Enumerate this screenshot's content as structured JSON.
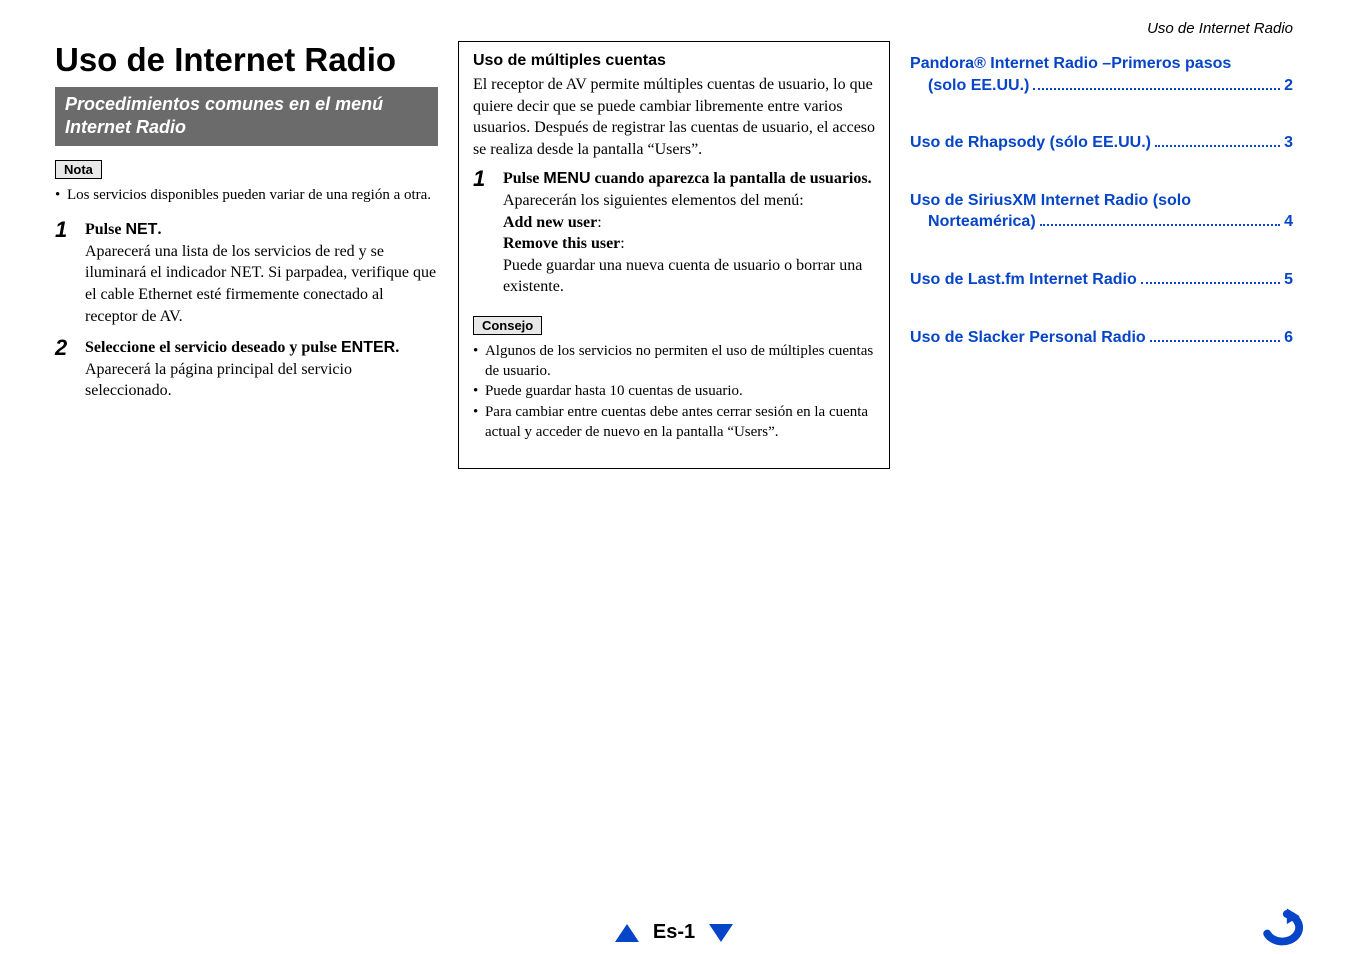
{
  "header": {
    "running_head": "Uso de Internet Radio"
  },
  "col1": {
    "title": "Uso de Internet Radio",
    "section_bar": "Procedimientos comunes en el menú Internet Radio",
    "nota_label": "Nota",
    "nota_bullet": "Los servicios disponibles pueden variar de una región a otra.",
    "steps": [
      {
        "num": "1",
        "lead_pre": "Pulse ",
        "lead_sans": "NET",
        "lead_post": ".",
        "body": "Aparecerá una lista de los servicios de red y se iluminará el indicador NET. Si parpadea, verifique que el cable Ethernet esté firmemente conectado al receptor de AV."
      },
      {
        "num": "2",
        "lead_pre": "Seleccione el servicio deseado y pulse ",
        "lead_sans": "ENTER",
        "lead_post": ".",
        "body": "Aparecerá la página principal del servicio seleccionado."
      }
    ]
  },
  "col2": {
    "heading": "Uso de múltiples cuentas",
    "intro": "El receptor de AV permite múltiples cuentas de usuario, lo que quiere decir que se puede cambiar libremente entre varios usuarios. Después de registrar las cuentas de usuario, el acceso se realiza desde la pantalla “Users”.",
    "step": {
      "num": "1",
      "lead_pre": "Pulse ",
      "lead_sans": "MENU",
      "lead_post": " cuando aparezca la pantalla de usuarios.",
      "after": "Aparecerán los siguientes elementos del menú:",
      "opt1": "Add new user",
      "opt2": "Remove this user",
      "tail": "Puede guardar una nueva cuenta de usuario o borrar una existente."
    },
    "consejo_label": "Consejo",
    "consejo_bullets": [
      "Algunos de los servicios no permiten el uso de múltiples cuentas de usuario.",
      "Puede guardar hasta 10 cuentas de usuario.",
      "Para cambiar entre cuentas debe antes cerrar sesión en la cuenta actual y acceder de nuevo en la pantalla “Users”."
    ]
  },
  "toc": [
    {
      "lines": [
        {
          "text": "Pandora® Internet Radio –Primeros pasos",
          "page": ""
        },
        {
          "text": "(solo EE.UU.)",
          "page": "2",
          "sub": true
        }
      ]
    },
    {
      "lines": [
        {
          "text": "Uso de Rhapsody (sólo EE.UU.)",
          "page": "3"
        }
      ]
    },
    {
      "lines": [
        {
          "text": "Uso de SiriusXM Internet Radio (solo",
          "page": ""
        },
        {
          "text": "Norteamérica)",
          "page": "4",
          "sub": true
        }
      ]
    },
    {
      "lines": [
        {
          "text": "Uso de Last.fm Internet Radio",
          "page": "5"
        }
      ]
    },
    {
      "lines": [
        {
          "text": "Uso de Slacker Personal Radio",
          "page": "6"
        }
      ]
    }
  ],
  "footer": {
    "page_label": "Es-1"
  }
}
